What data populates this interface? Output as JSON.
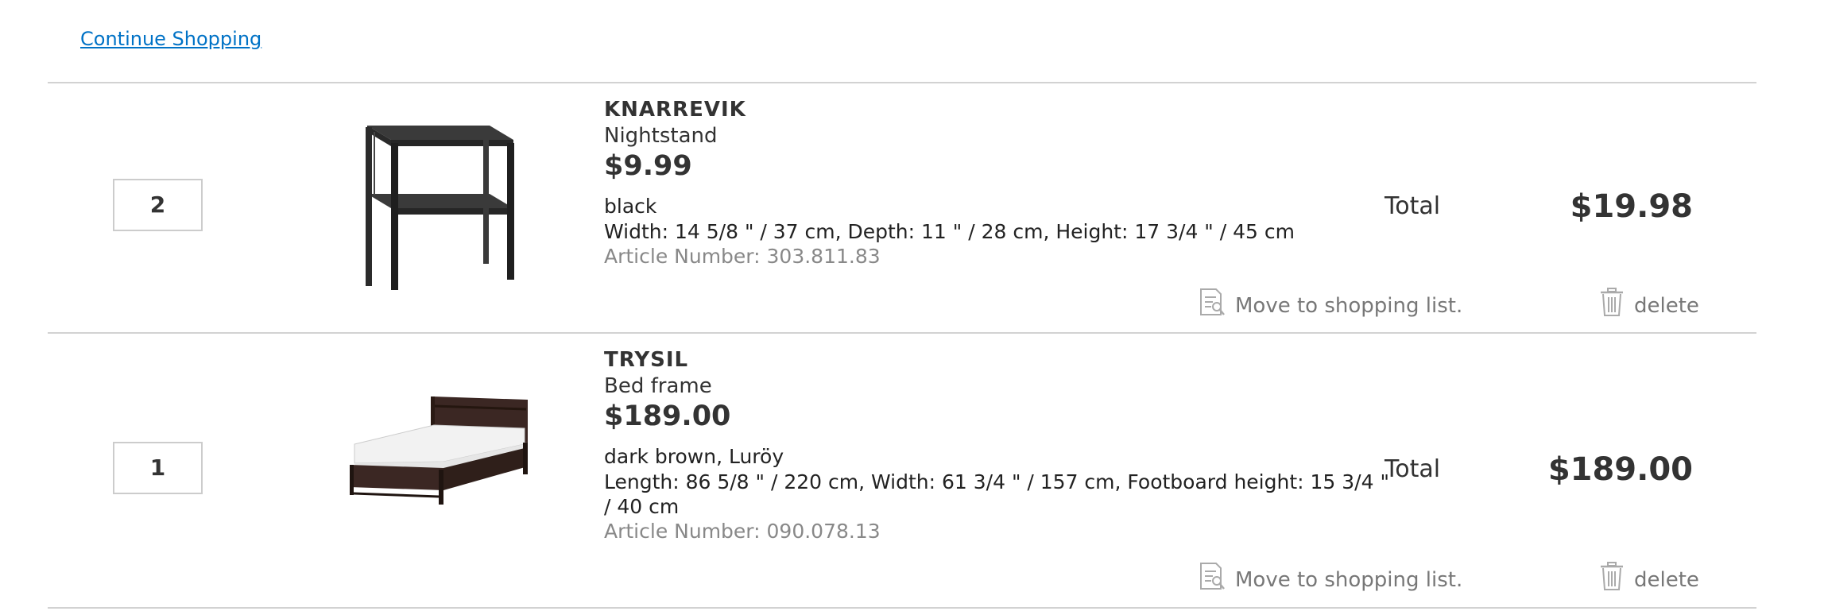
{
  "nav": {
    "continue_label": "Continue Shopping"
  },
  "cart": {
    "items": [
      {
        "quantity": "2",
        "name": "KNARREVIK",
        "type": "Nightstand",
        "price": "$9.99",
        "color": "black",
        "dimensions": "Width: 14 5/8 \" / 37 cm, Depth: 11 \" / 28 cm, Height: 17 3/4 \" / 45 cm",
        "article": "Article Number: 303.811.83",
        "total_label": "Total",
        "total_value": "$19.98",
        "move_label": "Move to shopping list.",
        "delete_label": "delete"
      },
      {
        "quantity": "1",
        "name": "TRYSIL",
        "type": "Bed frame",
        "price": "$189.00",
        "color": "dark brown, Luröy",
        "dimensions": "Length: 86 5/8 \" / 220 cm, Width: 61 3/4 \" / 157 cm, Footboard height: 15 3/4 \" / 40 cm",
        "article": "Article Number: 090.078.13",
        "total_label": "Total",
        "total_value": "$189.00",
        "move_label": "Move to shopping list.",
        "delete_label": "delete"
      }
    ]
  },
  "icons": {
    "move": "shopping-list-icon",
    "delete": "trash-icon",
    "item1_image": "nightstand-image",
    "item2_image": "bed-frame-image"
  },
  "colors": {
    "link": "#0072c6",
    "text": "#333333",
    "muted": "#888888",
    "divider": "#d2d2d2"
  }
}
